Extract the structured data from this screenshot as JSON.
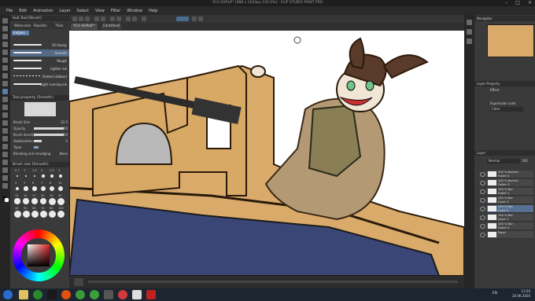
{
  "window": {
    "title": "YCH SHRUF* [880 x 1024px 150.0%] - CLIP STUDIO PAINT PRO"
  },
  "menu": [
    "File",
    "Edit",
    "Animation",
    "Layer",
    "Select",
    "View",
    "Filter",
    "Window",
    "Help"
  ],
  "tool_tabs": [
    {
      "label": "Sub Tool [Brush]"
    }
  ],
  "document_tabs": [
    {
      "label": "YCH SHRUF*"
    },
    {
      "label": "[Untitled]"
    }
  ],
  "brush_tabs": [
    "Watercolor",
    "Realistic",
    "Thick"
  ],
  "brushes": [
    {
      "label": "Oil Husky"
    },
    {
      "label": "Smooth",
      "selected": true
    },
    {
      "label": "Rough"
    },
    {
      "label": "Lighter ink"
    },
    {
      "label": "Dotted (ribbon)"
    },
    {
      "label": "Light running ink"
    }
  ],
  "tool_property": {
    "title": "Tool property [Smooth]",
    "rows": [
      {
        "label": "Brush Size",
        "value": "22.5"
      },
      {
        "label": "Opacity",
        "value": "100"
      },
      {
        "label": "Brush density",
        "value": "100"
      },
      {
        "label": "Stabilization",
        "value": "5"
      },
      {
        "label": "Taper",
        "value": ""
      },
      {
        "label": "Blending and smudging",
        "value": "None"
      }
    ]
  },
  "brush_size": {
    "title": "Brush size [Smooth]",
    "numbers": [
      "0.7",
      "1",
      "1.5",
      "2",
      "2.5",
      "3",
      "4",
      "5",
      "6",
      "7",
      "8",
      "10",
      "12",
      "15",
      "17",
      "20",
      "25",
      "30",
      "40",
      "50",
      "60",
      "70",
      "80",
      "100"
    ]
  },
  "right_panel": {
    "navigator_title": "Navigator",
    "layer_property_title": "Layer Property",
    "effect_label": "Effect",
    "expression_label": "Expression color",
    "expression_value": "Color",
    "blend_mode": "Normal",
    "opacity": "100",
    "layers": [
      {
        "name": "100 % Normal",
        "sub": "Folder 4",
        "selected": false
      },
      {
        "name": "100 % Normal",
        "sub": "Folder 3",
        "selected": false
      },
      {
        "name": "100 % Nor",
        "sub": "Folder 1",
        "selected": false
      },
      {
        "name": "100 % Nor",
        "sub": "Layer 3",
        "selected": false
      },
      {
        "name": "100 % Nor",
        "sub": "Layer 2",
        "selected": true
      },
      {
        "name": "100 % Nor",
        "sub": "Layer 1",
        "selected": false
      },
      {
        "name": "100 % Nor",
        "sub": "Folder 2",
        "selected": false
      },
      {
        "name": "",
        "sub": "Paper",
        "selected": false
      }
    ]
  },
  "taskbar": {
    "language": "EN",
    "time": "13:50",
    "date": "20.06.2020"
  },
  "colors": {
    "accent": "#546a86",
    "canvas_tan": "#d4a468",
    "window_blue": "#3a4676"
  }
}
